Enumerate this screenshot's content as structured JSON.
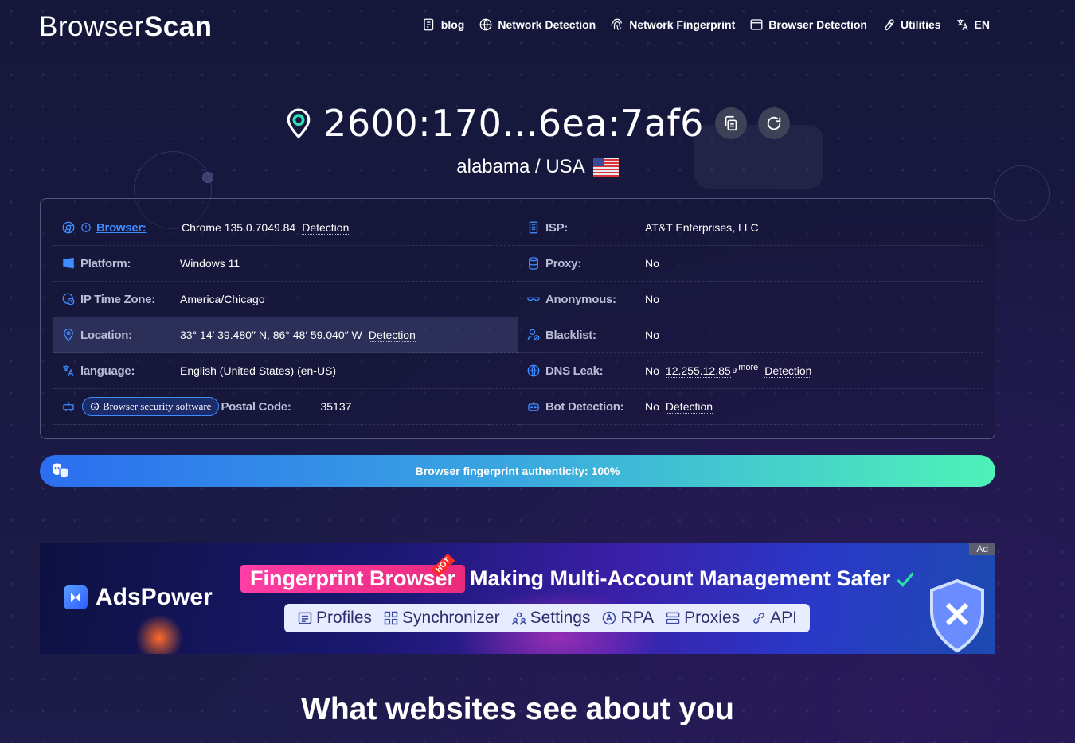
{
  "header": {
    "logo": {
      "part1": "Browser",
      "part2": "Scan"
    },
    "nav": [
      {
        "label": "blog",
        "icon": "blog-icon"
      },
      {
        "label": "Network Detection",
        "icon": "globe-icon"
      },
      {
        "label": "Network Fingerprint",
        "icon": "fingerprint-icon"
      },
      {
        "label": "Browser Detection",
        "icon": "browser-window-icon"
      },
      {
        "label": "Utilities",
        "icon": "wrench-icon"
      },
      {
        "label": "EN",
        "icon": "translate-icon"
      }
    ]
  },
  "hero": {
    "ip": "2600:170...6ea:7af6",
    "location": "alabama / USA",
    "flag": "us-flag"
  },
  "info": {
    "left": [
      {
        "label": "Browser:",
        "value": "Chrome 135.0.7049.84",
        "link": "Detection"
      },
      {
        "label": "Platform:",
        "value": "Windows 11"
      },
      {
        "label": "IP Time Zone:",
        "value": "America/Chicago"
      },
      {
        "label": "Location:",
        "value": "33° 14′ 39.480″ N, 86° 48′ 59.040″ W",
        "link": "Detection"
      },
      {
        "label": "language:",
        "value": "English (United States) (en-US)"
      },
      {
        "button": "Browser security software",
        "label": "Postal Code:",
        "value": "35137"
      }
    ],
    "right": [
      {
        "label": "ISP:",
        "value": "AT&T Enterprises, LLC"
      },
      {
        "label": "Proxy:",
        "value": "No"
      },
      {
        "label": "Anonymous:",
        "value": "No"
      },
      {
        "label": "Blacklist:",
        "value": "No"
      },
      {
        "label": "DNS Leak:",
        "value": "No",
        "ip": "12.255.12.85",
        "count": "9",
        "more": "more",
        "link": "Detection"
      },
      {
        "label": "Bot Detection:",
        "value": "No",
        "link": "Detection"
      }
    ]
  },
  "authenticity": {
    "text": "Browser fingerprint authenticity: 100%",
    "percent": 100
  },
  "ad": {
    "brand": "AdsPower",
    "pill": "Fingerprint Browser",
    "hot": "HOT",
    "headline": "Making Multi-Account Management Safer",
    "features": [
      "Profiles",
      "Synchronizer",
      "Settings",
      "RPA",
      "Proxies",
      "API"
    ],
    "tag": "Ad"
  },
  "section_title": "What websites see about you",
  "colors": {
    "accent": "#3e8cff",
    "bar_start": "#2b6ef0",
    "bar_end": "#4ff2b8",
    "pill": "#ff3ea6"
  }
}
